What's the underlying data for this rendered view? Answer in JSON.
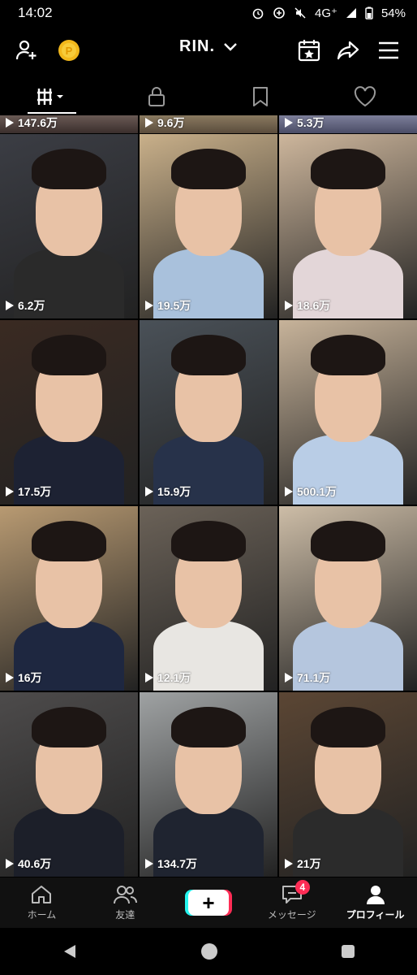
{
  "status": {
    "time": "14:02",
    "network": "4G⁺",
    "battery": "54%"
  },
  "header": {
    "username": "RIN."
  },
  "tabs": [
    {
      "name": "videos",
      "icon": "grid-icon"
    },
    {
      "name": "private",
      "icon": "lock-icon"
    },
    {
      "name": "saved",
      "icon": "bookmark-icon"
    },
    {
      "name": "liked",
      "icon": "heart-icon"
    }
  ],
  "top_strip_views": [
    "147.6万",
    "9.6万",
    "5.3万"
  ],
  "videos": [
    {
      "views": "6.2万",
      "bg": "#3b3d44",
      "shirt": "#2a2a2a"
    },
    {
      "views": "19.5万",
      "bg": "#c9b08a",
      "shirt": "#a9c1dc"
    },
    {
      "views": "18.6万",
      "bg": "#cdb69c",
      "shirt": "#e3d6d8"
    },
    {
      "views": "17.5万",
      "bg": "#3a2a22",
      "shirt": "#1d2233"
    },
    {
      "views": "15.9万",
      "bg": "#4a5158",
      "shirt": "#27324a"
    },
    {
      "views": "500.1万",
      "bg": "#c7b39a",
      "shirt": "#b9cde6"
    },
    {
      "views": "16万",
      "bg": "#b89a72",
      "shirt": "#1e2740"
    },
    {
      "views": "12.1万",
      "bg": "#6b6258",
      "shirt": "#e8e6e2"
    },
    {
      "views": "71.1万",
      "bg": "#cdbda7",
      "shirt": "#b5c6de"
    },
    {
      "views": "40.6万",
      "bg": "#4d4b4b",
      "shirt": "#1c1f29"
    },
    {
      "views": "134.7万",
      "bg": "#9fa2a3",
      "shirt": "#1f2430"
    },
    {
      "views": "21万",
      "bg": "#5b4634",
      "shirt": "#2b2b2b"
    }
  ],
  "nav": {
    "home": "ホーム",
    "friends": "友達",
    "messages": "メッセージ",
    "messages_badge": "4",
    "profile": "プロフィール"
  }
}
